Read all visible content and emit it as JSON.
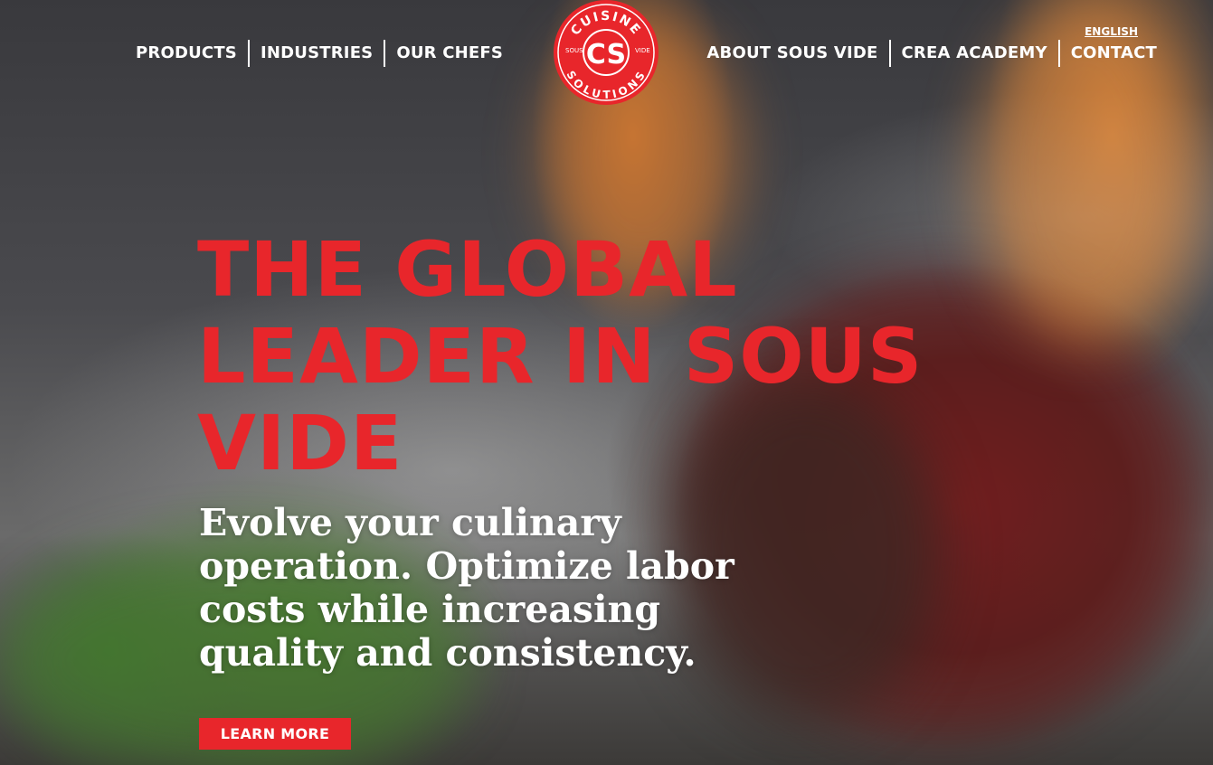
{
  "nav": {
    "left": [
      "PRODUCTS",
      "INDUSTRIES",
      "OUR CHEFS"
    ],
    "right": [
      "ABOUT SOUS VIDE",
      "CREA ACADEMY",
      "CONTACT"
    ],
    "language": "ENGLISH"
  },
  "logo": {
    "top_text": "CUISINE",
    "bottom_text": "SOLUTIONS",
    "left_text": "SOUS",
    "right_text": "VIDE",
    "monogram": "CS",
    "color": "#e8262b"
  },
  "hero": {
    "headline_lines": [
      "THE GLOBAL",
      "LEADER IN SOUS",
      "VIDE"
    ],
    "subhead_lines": [
      "Evolve your culinary",
      "operation. Optimize labor",
      "costs while increasing",
      "quality and consistency."
    ],
    "cta_label": "LEARN MORE"
  },
  "colors": {
    "accent": "#e8262b",
    "text": "#ffffff"
  }
}
